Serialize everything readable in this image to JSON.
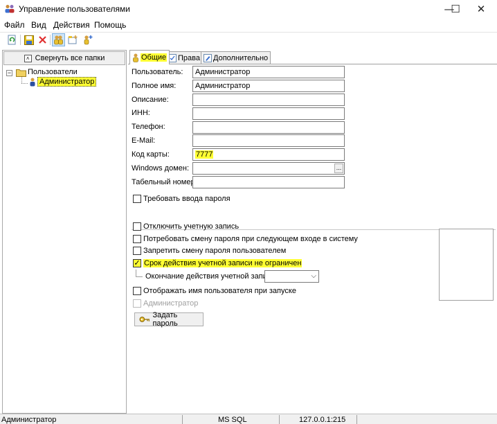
{
  "window": {
    "title": "Управление пользователями",
    "minimize": "—",
    "maximize": "☐",
    "close": "✕"
  },
  "menu": [
    "Файл",
    "Вид",
    "Действия",
    "Помощь"
  ],
  "toolbar": {
    "icons": [
      "refresh-icon",
      "save-icon",
      "delete-icon",
      "users-icon",
      "add-group-icon",
      "add-user-icon"
    ]
  },
  "left_panel": {
    "collapse_button": "Свернуть все папки",
    "collapse_glyph": "˄",
    "tree_toggle": "−",
    "tree_root": "Пользователи",
    "tree_selected": "Администратор"
  },
  "tabs": [
    "Общие",
    "Права",
    "Дополнительно"
  ],
  "form": {
    "fields": [
      {
        "label": "Пользователь:",
        "value": ""
      },
      {
        "label": "Полное имя:",
        "value": "Администратор"
      },
      {
        "label": "Описание:",
        "value": ""
      },
      {
        "label": "ИНН:",
        "value": ""
      },
      {
        "label": "Телефон:",
        "value": ""
      },
      {
        "label": "E-Mail:",
        "value": ""
      },
      {
        "label": "Код карты:",
        "value": "7777"
      },
      {
        "label": "Windows домен:",
        "value": ""
      },
      {
        "label": "Табельный номер:",
        "value": ""
      }
    ],
    "user_value": "Администратор",
    "ellipsis": "..."
  },
  "checkboxes": {
    "require_password": {
      "label": "Требовать ввода пароля",
      "checked": false
    },
    "disable_account": {
      "label": "Отключить учетную запись",
      "checked": false
    },
    "force_change": {
      "label": "Потребовать смену пароля при следующем входе в систему",
      "checked": false
    },
    "forbid_change": {
      "label": "Запретить смену пароля пользователем",
      "checked": false
    },
    "no_expiry": {
      "label": "Срок действия учетной записи не ограничен",
      "checked": true
    },
    "show_name": {
      "label": "Отображать имя пользователя при запуске",
      "checked": false
    },
    "admin": {
      "label": "Администратор",
      "checked": false
    }
  },
  "expiry_label": "Окончание действия учетной записи",
  "expiry_value": "",
  "check_mark": "✓",
  "select_arrow": "⌵",
  "set_password_button": "Задать пароль",
  "status": {
    "user": "Администратор",
    "db": "MS SQL",
    "host": "127.0.0.1:215"
  },
  "colors": {
    "highlight": "#ffff33",
    "accent": "#0078d7"
  }
}
